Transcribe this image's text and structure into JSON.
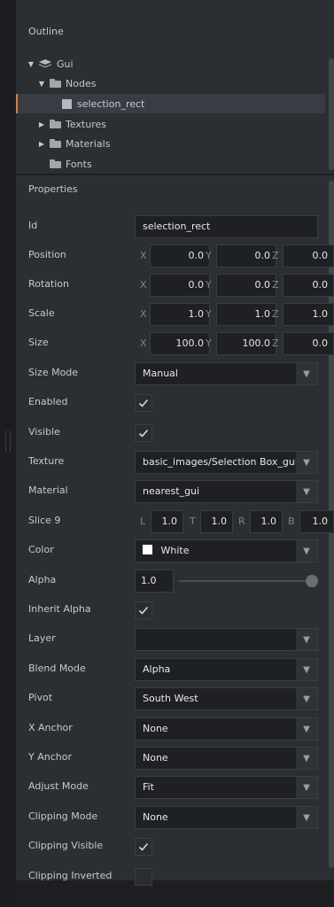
{
  "outline": {
    "title": "Outline",
    "tree": {
      "gui": "Gui",
      "nodes": "Nodes",
      "selected_node": "selection_rect",
      "textures": "Textures",
      "materials": "Materials",
      "fonts": "Fonts"
    }
  },
  "properties": {
    "title": "Properties",
    "id": {
      "label": "Id",
      "value": "selection_rect"
    },
    "position": {
      "label": "Position",
      "x": "0.0",
      "y": "0.0",
      "z": "0.0"
    },
    "rotation": {
      "label": "Rotation",
      "x": "0.0",
      "y": "0.0",
      "z": "0.0"
    },
    "scale": {
      "label": "Scale",
      "x": "1.0",
      "y": "1.0",
      "z": "1.0"
    },
    "size": {
      "label": "Size",
      "x": "100.0",
      "y": "100.0",
      "z": "0.0"
    },
    "size_mode": {
      "label": "Size Mode",
      "value": "Manual"
    },
    "enabled": {
      "label": "Enabled",
      "checked": true
    },
    "visible": {
      "label": "Visible",
      "checked": true
    },
    "texture": {
      "label": "Texture",
      "value": "basic_images/Selection Box_gui_"
    },
    "material": {
      "label": "Material",
      "value": "nearest_gui"
    },
    "slice9": {
      "label": "Slice 9",
      "l": "1.0",
      "t": "1.0",
      "r": "1.0",
      "b": "1.0"
    },
    "color": {
      "label": "Color",
      "value": "White",
      "swatch": "#ffffff"
    },
    "alpha": {
      "label": "Alpha",
      "value": "1.0",
      "slider_fraction": 1.0
    },
    "inherit_alpha": {
      "label": "Inherit Alpha",
      "checked": true
    },
    "layer": {
      "label": "Layer",
      "value": ""
    },
    "blend_mode": {
      "label": "Blend Mode",
      "value": "Alpha"
    },
    "pivot": {
      "label": "Pivot",
      "value": "South West"
    },
    "x_anchor": {
      "label": "X Anchor",
      "value": "None"
    },
    "y_anchor": {
      "label": "Y Anchor",
      "value": "None"
    },
    "adjust_mode": {
      "label": "Adjust Mode",
      "value": "Fit"
    },
    "clipping_mode": {
      "label": "Clipping Mode",
      "value": "None"
    },
    "clipping_visible": {
      "label": "Clipping Visible",
      "checked": true
    },
    "clipping_inverted": {
      "label": "Clipping Inverted",
      "checked": false
    }
  },
  "axes": {
    "x": "X",
    "y": "Y",
    "z": "Z",
    "l": "L",
    "t": "T",
    "r": "R",
    "b": "B"
  },
  "colors": {
    "accent": "#e07b39",
    "panel": "#2b2e33",
    "field": "#1e2024"
  }
}
